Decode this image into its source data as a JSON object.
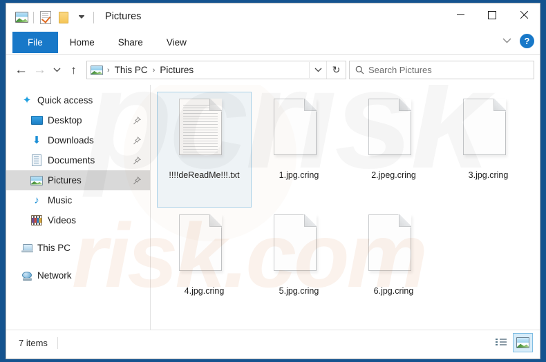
{
  "window": {
    "title": "Pictures",
    "quick_access_toolbar": [
      {
        "name": "picture-folder-icon",
        "label": "Pictures"
      },
      {
        "name": "properties-icon",
        "label": "Properties"
      },
      {
        "name": "new-folder-icon",
        "label": "New folder"
      },
      {
        "name": "customize-chevron-icon",
        "label": "Customize Quick Access Toolbar"
      }
    ],
    "controls": {
      "minimize": "Minimize",
      "maximize": "Maximize",
      "close": "Close"
    }
  },
  "ribbon": {
    "tabs": [
      {
        "label": "File",
        "active": true
      },
      {
        "label": "Home",
        "active": false
      },
      {
        "label": "Share",
        "active": false
      },
      {
        "label": "View",
        "active": false
      }
    ],
    "collapse_label": "Expand the Ribbon",
    "help_label": "?"
  },
  "address_bar": {
    "back_label": "Back",
    "forward_label": "Forward",
    "recent_label": "Recent locations",
    "up_label": "Up to This PC",
    "breadcrumb": [
      {
        "label": "This PC"
      },
      {
        "label": "Pictures"
      }
    ],
    "separator": "›",
    "dropdown_label": "Previous Locations",
    "refresh_label": "Refresh Pictures",
    "search": {
      "placeholder": "Search Pictures",
      "value": ""
    }
  },
  "sidebar": {
    "items": [
      {
        "label": "Quick access",
        "icon": "star-icon",
        "level": 0,
        "pinned": false,
        "selected": false
      },
      {
        "label": "Desktop",
        "icon": "desktop-icon",
        "level": 1,
        "pinned": true,
        "selected": false
      },
      {
        "label": "Downloads",
        "icon": "downloads-icon",
        "level": 1,
        "pinned": true,
        "selected": false
      },
      {
        "label": "Documents",
        "icon": "documents-icon",
        "level": 1,
        "pinned": true,
        "selected": false
      },
      {
        "label": "Pictures",
        "icon": "pictures-icon",
        "level": 1,
        "pinned": true,
        "selected": true
      },
      {
        "label": "Music",
        "icon": "music-icon",
        "level": 1,
        "pinned": false,
        "selected": false
      },
      {
        "label": "Videos",
        "icon": "videos-icon",
        "level": 1,
        "pinned": false,
        "selected": false
      },
      {
        "label": "This PC",
        "icon": "this-pc-icon",
        "level": 0,
        "pinned": false,
        "selected": false
      },
      {
        "label": "Network",
        "icon": "network-icon",
        "level": 0,
        "pinned": false,
        "selected": false
      }
    ]
  },
  "files": [
    {
      "name": "!!!!deReadMe!!!.txt",
      "type": "text-document",
      "selected": true
    },
    {
      "name": "1.jpg.cring",
      "type": "generic-file",
      "selected": false
    },
    {
      "name": "2.jpeg.cring",
      "type": "generic-file",
      "selected": false
    },
    {
      "name": "3.jpg.cring",
      "type": "generic-file",
      "selected": false
    },
    {
      "name": "4.jpg.cring",
      "type": "generic-file",
      "selected": false
    },
    {
      "name": "5.jpg.cring",
      "type": "generic-file",
      "selected": false
    },
    {
      "name": "6.jpg.cring",
      "type": "generic-file",
      "selected": false
    }
  ],
  "status_bar": {
    "item_count": "7 items",
    "views": [
      {
        "name": "details-view-button",
        "label": "Details view",
        "active": false
      },
      {
        "name": "large-icons-view-button",
        "label": "Large icons view",
        "active": true
      }
    ]
  },
  "watermark": {
    "back_text": "pcrisk",
    "front_text": "risk.com"
  },
  "colors": {
    "accent": "#1878c8",
    "desktop": "#14538f",
    "selection": "#a9d4ee",
    "sidebar_selected": "#d9d9d9"
  }
}
